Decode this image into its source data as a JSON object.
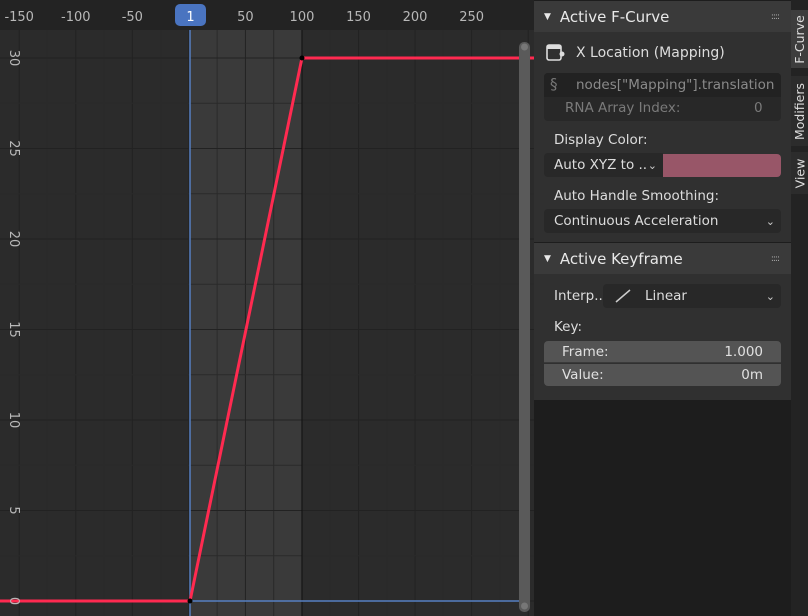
{
  "graph": {
    "current_frame": "1",
    "x_ticks": [
      -150,
      -100,
      -50,
      50,
      100,
      150,
      200,
      250
    ],
    "y_ticks": [
      0,
      5,
      10,
      15,
      20,
      25,
      30
    ],
    "scene_range": [
      1,
      100
    ],
    "curve_color": "#ff2a50",
    "keyframes": [
      {
        "frame": 1,
        "value": 0
      },
      {
        "frame": 100,
        "value": 30
      }
    ]
  },
  "sidebar": {
    "tabs": [
      "F-Curve",
      "Modifiers",
      "View"
    ],
    "active_fcurve": {
      "title": "Active F-Curve",
      "channel_name": "X Location (Mapping)",
      "data_path": "nodes[\"Mapping\"].translation",
      "rna_index_label": "RNA Array Index:",
      "rna_index_value": "0",
      "display_color_label": "Display Color:",
      "display_color_mode": "Auto XYZ to ..",
      "display_color": "#985668",
      "handle_smoothing_label": "Auto Handle Smoothing:",
      "handle_smoothing_value": "Continuous Acceleration"
    },
    "active_keyframe": {
      "title": "Active Keyframe",
      "interp_label": "Interp..",
      "interp_value": "Linear",
      "key_label": "Key:",
      "frame_label": "Frame:",
      "frame_value": "1.000",
      "value_label": "Value:",
      "value_value": "0m"
    }
  }
}
